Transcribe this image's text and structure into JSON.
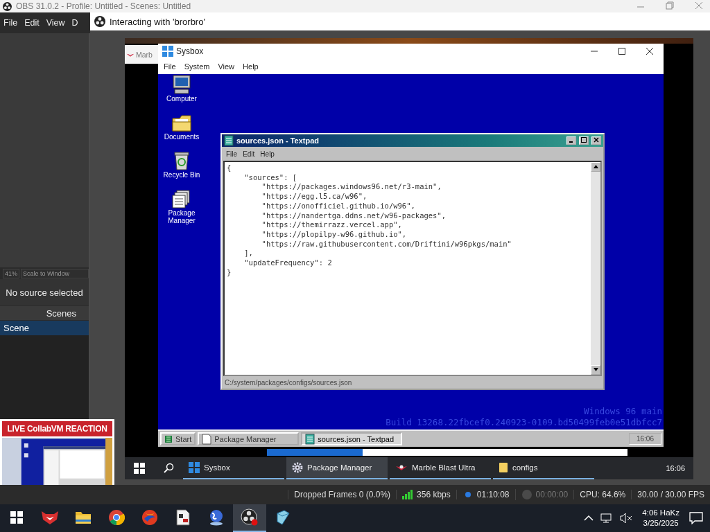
{
  "obs": {
    "title": "OBS 31.0.2 - Profile: Untitled - Scenes: Untitled",
    "menu": [
      "File",
      "Edit",
      "View",
      "D"
    ],
    "zoom": "41%",
    "scale_mode": "Scale to Window",
    "source_status": "No source selected",
    "scenes_header": "Scenes",
    "scenes": [
      {
        "name": "Scene",
        "selected": true
      }
    ],
    "overlay": {
      "banner": "LIVE CollabVM REACTION"
    }
  },
  "interact_window": {
    "title": "Interacting with 'brorbro'"
  },
  "vm": {
    "background_window": {
      "title": "Marb"
    },
    "sysbox": {
      "title": "Sysbox",
      "menu": [
        "File",
        "System",
        "View",
        "Help"
      ],
      "desktop_icons": [
        {
          "label": "Computer",
          "kind": "computer"
        },
        {
          "label": "Documents",
          "kind": "folder"
        },
        {
          "label": "Recycle Bin",
          "kind": "bin"
        },
        {
          "label": "Package Manager",
          "kind": "package"
        }
      ],
      "textpad": {
        "title": "sources.json - Textpad",
        "menu": [
          "File",
          "Edit",
          "Help"
        ],
        "lines": [
          "{",
          "    \"sources\": [",
          "        \"https://packages.windows96.net/r3-main\",",
          "        \"https://egg.l5.ca/w96\",",
          "        \"https://onofficiel.github.io/w96\",",
          "        \"https://nandertga.ddns.net/w96-packages\",",
          "        \"https://themirrazz.vercel.app\",",
          "        \"https://plopilpy-w96.github.io\",",
          "        \"https://raw.githubusercontent.com/Driftini/w96pkgs/main\"",
          "    ],",
          "    \"updateFrequency\": 2",
          "}"
        ],
        "path": "C:/system/packages/configs/sources.json"
      },
      "watermark": [
        "Windows 96 main",
        "Build 13268.22fbcef0.240923-0109.bd50499feb0e51dbfcc7"
      ],
      "taskbar": {
        "start": "Start",
        "items": [
          {
            "label": "Package Manager",
            "kind": "package",
            "selected": false
          },
          {
            "label": "sources.json - Textpad",
            "kind": "textpad",
            "selected": true
          }
        ],
        "clock": "16:06"
      }
    },
    "host_taskbar": {
      "items": [
        {
          "label": "Sysbox",
          "kind": "sysbox",
          "selected": false
        },
        {
          "label": "Package Manager",
          "kind": "gear",
          "selected": true
        },
        {
          "label": "Marble Blast Ultra",
          "kind": "marble",
          "selected": false
        },
        {
          "label": "configs",
          "kind": "folder",
          "selected": false
        }
      ],
      "clock": "16:06"
    }
  },
  "status_bar": [
    {
      "kind": "text",
      "text": "Dropped Frames 0 (0.0%)"
    },
    {
      "kind": "bitrate",
      "text": "356 kbps"
    },
    {
      "kind": "stream",
      "text": "01:10:08",
      "active": true
    },
    {
      "kind": "record",
      "text": "00:00:00",
      "active": false
    },
    {
      "kind": "text",
      "text": "CPU: 64.6%"
    },
    {
      "kind": "text",
      "text": "30.00 / 30.00 FPS"
    }
  ],
  "taskbar": {
    "apps": [
      {
        "kind": "fox",
        "selected": false
      },
      {
        "kind": "folder",
        "selected": false
      },
      {
        "kind": "browser",
        "selected": false
      },
      {
        "kind": "swirl",
        "selected": false
      },
      {
        "kind": "document",
        "selected": false
      },
      {
        "kind": "globe",
        "selected": false
      },
      {
        "kind": "obs",
        "selected": true
      },
      {
        "kind": "cube",
        "selected": false
      }
    ],
    "time": "4:06 HaKz",
    "date": "3/25/2025"
  }
}
